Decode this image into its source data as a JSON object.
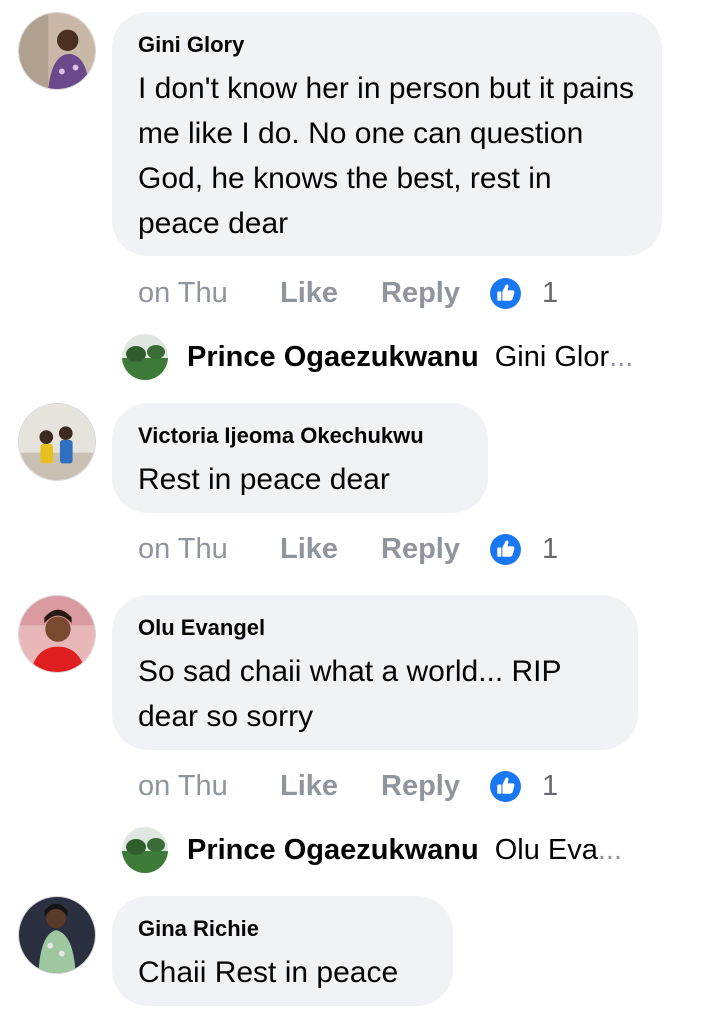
{
  "comments": [
    {
      "author": "Gini Glory",
      "text": "I don't know her in person but it pains me like I do. No one can question God, he knows the best, rest in peace dear",
      "time": "on Thu",
      "like": "Like",
      "reply": "Reply",
      "reactions": "1",
      "reply_preview": {
        "name": "Prince Ogaezukwanu",
        "snippet": "Gini Glor",
        "ellipsis": "..."
      }
    },
    {
      "author": "Victoria Ijeoma Okechukwu",
      "text": "Rest in peace dear",
      "time": "on Thu",
      "like": "Like",
      "reply": "Reply",
      "reactions": "1"
    },
    {
      "author": "Olu Evangel",
      "text": "So sad chaii what a world... RIP dear so sorry",
      "time": "on Thu",
      "like": "Like",
      "reply": "Reply",
      "reactions": "1",
      "reply_preview": {
        "name": "Prince Ogaezukwanu",
        "snippet": "Olu Eva",
        "ellipsis": "..."
      }
    },
    {
      "author": "Gina Richie",
      "text": "Chaii Rest in peace"
    }
  ],
  "colors": {
    "bubble": "#f0f2f5",
    "meta_text": "#90949c",
    "like_icon": "#1877f2"
  },
  "icons": {
    "reaction": "like-thumbs-up-icon"
  }
}
